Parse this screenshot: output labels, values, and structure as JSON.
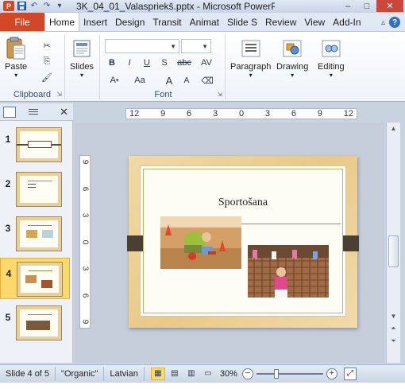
{
  "titlebar": {
    "title": "3K_04_01_Valaspriekš.pptx - Microsoft PowerP...",
    "app_icon": "P",
    "buttons": [
      "minimize-icon",
      "maximize-icon",
      "close-icon"
    ]
  },
  "tabs": {
    "file": "File",
    "items": [
      "Home",
      "Insert",
      "Design",
      "Transit",
      "Animat",
      "Slide S",
      "Review",
      "View",
      "Add-In"
    ],
    "active": "Home"
  },
  "ribbon": {
    "clipboard": {
      "label": "Clipboard",
      "paste": "Paste"
    },
    "slides": {
      "label": "Slides",
      "button": "Slides"
    },
    "font": {
      "label": "Font",
      "bold": "B",
      "italic": "I",
      "underline": "U",
      "shadow": "S",
      "strike": "abc",
      "spacing": "AV",
      "change_case": "Aa",
      "grow": "A",
      "shrink": "A"
    },
    "paragraph": {
      "button": "Paragraph"
    },
    "drawing": {
      "button": "Drawing"
    },
    "editing": {
      "button": "Editing"
    }
  },
  "slide_pane": {
    "slides": [
      {
        "number": "1",
        "title": ""
      },
      {
        "number": "2",
        "title": ""
      },
      {
        "number": "3",
        "title": ""
      },
      {
        "number": "4",
        "title": ""
      },
      {
        "number": "5",
        "title": ""
      }
    ],
    "selected": "4"
  },
  "ruler": {
    "horizontal": [
      "12",
      "9",
      "6",
      "3",
      "0",
      "3",
      "6",
      "9",
      "12"
    ],
    "vertical": [
      "9",
      "6",
      "3",
      "0",
      "3",
      "6",
      "9"
    ]
  },
  "slide": {
    "title": "Sportošana"
  },
  "statusbar": {
    "slide_info": "Slide 4 of 5",
    "theme": "\"Organic\"",
    "language": "Latvian",
    "zoom": "30%",
    "zoom_out": "−",
    "zoom_in": "+"
  }
}
